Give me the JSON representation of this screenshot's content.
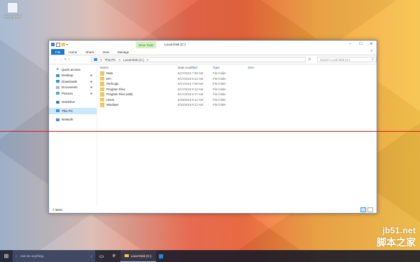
{
  "desktop": {
    "icon_label": "Recycle Bin"
  },
  "window": {
    "title": "Local Disk (C:)",
    "contextual_tab": "Drive Tools",
    "tabs": [
      "File",
      "Home",
      "Share",
      "View",
      "Manage"
    ],
    "controls": {
      "minimize": "–",
      "maximize": "☐",
      "close": "✕"
    },
    "help": "?"
  },
  "address": {
    "segments": [
      "This PC",
      "Local Disk (C:)"
    ],
    "separator": ">",
    "search_placeholder": "Search Local Disk (C:)"
  },
  "nav_pane": {
    "quick_access": "Quick access",
    "quick_items": [
      "Desktop",
      "Downloads",
      "Documents",
      "Pictures"
    ],
    "onedrive": "OneDrive",
    "this_pc": "This PC",
    "network": "Network"
  },
  "columns": {
    "name": "Name",
    "date": "Date modified",
    "type": "Type",
    "size": "Size"
  },
  "files": [
    {
      "name": "Data",
      "date": "5/17/2015 7:08 AM",
      "type": "File folder"
    },
    {
      "name": "EFI",
      "date": "5/17/2015 6:42 AM",
      "type": "File folder"
    },
    {
      "name": "PerfLogs",
      "date": "5/17/2015 7:08 AM",
      "type": "File folder"
    },
    {
      "name": "Program Files",
      "date": "5/17/2015 8:13 AM",
      "type": "File folder"
    },
    {
      "name": "Program Files (x86)",
      "date": "5/17/2015 8:17 AM",
      "type": "File folder"
    },
    {
      "name": "Users",
      "date": "5/23/2015 9:12 AM",
      "type": "File folder"
    },
    {
      "name": "Windows",
      "date": "5/23/2015 9:12 AM",
      "type": "File folder"
    }
  ],
  "status": {
    "items": "7 items"
  },
  "taskbar": {
    "search_placeholder": "Ask me anything",
    "app_label": "Local Disk (C:)"
  },
  "watermark": {
    "line1": "jb51.net",
    "line2": "脚本之家"
  },
  "colors": {
    "accent": "#1979ca",
    "contextual": "#d6f1c1",
    "selected": "#cce8ff",
    "marker_line": "#d41c1c"
  }
}
